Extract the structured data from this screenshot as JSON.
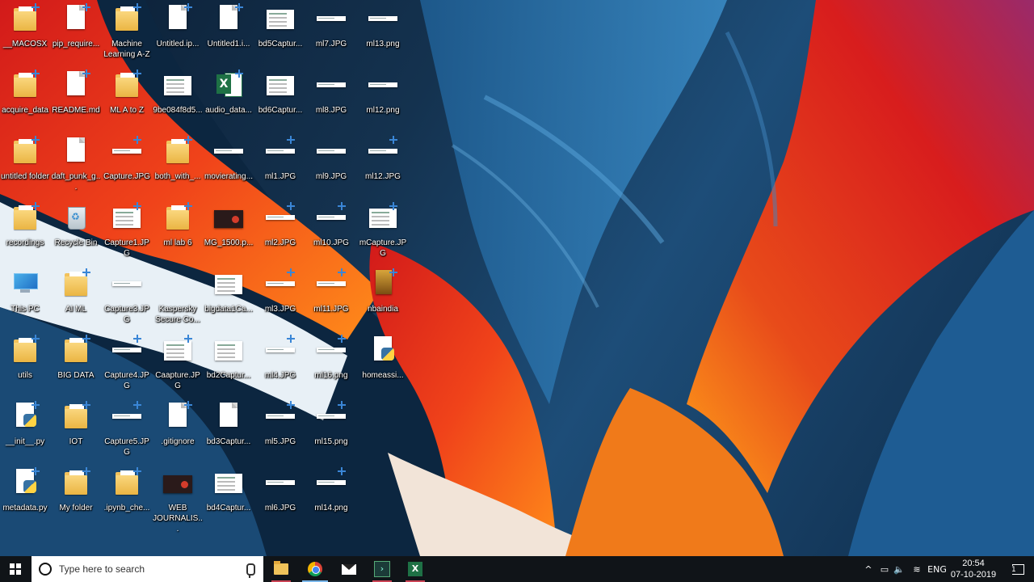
{
  "desktop": {
    "icons": [
      {
        "label": "__MACOSX",
        "kind": "folder",
        "badge": true
      },
      {
        "label": "acquire_data",
        "kind": "folder",
        "badge": true
      },
      {
        "label": "untitled folder",
        "kind": "folder",
        "badge": true
      },
      {
        "label": "recordings",
        "kind": "folder",
        "badge": true
      },
      {
        "label": "This PC",
        "kind": "pc",
        "badge": false
      },
      {
        "label": "utils",
        "kind": "folder",
        "badge": true
      },
      {
        "label": "__init__.py",
        "kind": "python",
        "badge": true
      },
      {
        "label": "metadata.py",
        "kind": "python",
        "badge": true
      },
      {
        "label": "pip_require...",
        "kind": "doc",
        "badge": true
      },
      {
        "label": "README.md",
        "kind": "doc",
        "badge": true
      },
      {
        "label": "daft_punk_g...",
        "kind": "doc",
        "badge": false
      },
      {
        "label": "Recycle Bin",
        "kind": "bin",
        "badge": false
      },
      {
        "label": "AI ML",
        "kind": "folder",
        "badge": true
      },
      {
        "label": "BIG DATA",
        "kind": "folder",
        "badge": true
      },
      {
        "label": "IOT",
        "kind": "folder",
        "badge": true
      },
      {
        "label": "My folder",
        "kind": "folder",
        "badge": true
      },
      {
        "label": "Machine Learning A-Z",
        "kind": "folder",
        "badge": true
      },
      {
        "label": "ML A to Z",
        "kind": "folder",
        "badge": true
      },
      {
        "label": "Capture.JPG",
        "kind": "strip",
        "badge": true
      },
      {
        "label": "Capture1.JPG",
        "kind": "shot",
        "badge": true
      },
      {
        "label": "Capture3.JPG",
        "kind": "strip",
        "badge": false
      },
      {
        "label": "Capture4.JPG",
        "kind": "strip",
        "badge": true
      },
      {
        "label": "Capture5.JPG",
        "kind": "strip",
        "badge": true
      },
      {
        "label": ".ipynb_che...",
        "kind": "folder",
        "badge": true
      },
      {
        "label": "Untitled.ip...",
        "kind": "doc",
        "badge": true
      },
      {
        "label": "9be084f8d5...",
        "kind": "shot",
        "badge": false
      },
      {
        "label": "both_with_...",
        "kind": "folder",
        "badge": true
      },
      {
        "label": "ml lab 6",
        "kind": "folder",
        "badge": true
      },
      {
        "label": "Kaspersky Secure Co...",
        "kind": "kaspersky",
        "badge": false
      },
      {
        "label": "Caapture.JPG",
        "kind": "shot",
        "badge": true
      },
      {
        "label": ".gitignore",
        "kind": "doc",
        "badge": true
      },
      {
        "label": "WEB JOURNALIS...",
        "kind": "dark",
        "badge": false
      },
      {
        "label": "Untitled1.i...",
        "kind": "doc",
        "badge": true
      },
      {
        "label": "audio_data...",
        "kind": "excel",
        "badge": true
      },
      {
        "label": "movierating...",
        "kind": "strip",
        "badge": false
      },
      {
        "label": "MG_1500.p...",
        "kind": "dark",
        "badge": false
      },
      {
        "label": "bigdata1Ca...",
        "kind": "shot",
        "badge": false
      },
      {
        "label": "bd2Captur...",
        "kind": "shot",
        "badge": false
      },
      {
        "label": "bd3Captur...",
        "kind": "doc",
        "badge": false
      },
      {
        "label": "bd4Captur...",
        "kind": "shot",
        "badge": false
      },
      {
        "label": "bd5Captur...",
        "kind": "shot",
        "badge": false
      },
      {
        "label": "bd6Captur...",
        "kind": "shot",
        "badge": false
      },
      {
        "label": "ml1.JPG",
        "kind": "strip",
        "badge": true
      },
      {
        "label": "ml2.JPG",
        "kind": "strip",
        "badge": true
      },
      {
        "label": "ml3.JPG",
        "kind": "strip",
        "badge": true
      },
      {
        "label": "ml4.JPG",
        "kind": "strip",
        "badge": true
      },
      {
        "label": "ml5.JPG",
        "kind": "strip",
        "badge": true
      },
      {
        "label": "ml6.JPG",
        "kind": "strip",
        "badge": false
      },
      {
        "label": "ml7.JPG",
        "kind": "strip",
        "badge": false
      },
      {
        "label": "ml8.JPG",
        "kind": "strip",
        "badge": false
      },
      {
        "label": "ml9.JPG",
        "kind": "strip",
        "badge": false
      },
      {
        "label": "ml10.JPG",
        "kind": "strip",
        "badge": true
      },
      {
        "label": "ml11.JPG",
        "kind": "strip",
        "badge": true
      },
      {
        "label": "ml16.png",
        "kind": "strip",
        "badge": true
      },
      {
        "label": "ml15.png",
        "kind": "strip",
        "badge": true
      },
      {
        "label": "ml14.png",
        "kind": "strip",
        "badge": true
      },
      {
        "label": "ml13.png",
        "kind": "strip",
        "badge": false
      },
      {
        "label": "ml12.png",
        "kind": "strip",
        "badge": false
      },
      {
        "label": "ml12.JPG",
        "kind": "strip",
        "badge": true
      },
      {
        "label": "mCapture.JPG",
        "kind": "shot",
        "badge": true
      },
      {
        "label": "nbaindia",
        "kind": "book",
        "badge": true
      },
      {
        "label": "homeassi...",
        "kind": "python",
        "badge": false
      }
    ]
  },
  "taskbar": {
    "search_placeholder": "Type here to search",
    "language": "ENG",
    "time": "20:54",
    "date": "07-10-2019",
    "notification_count": "1",
    "apps": [
      {
        "name": "file-explorer",
        "state": "running"
      },
      {
        "name": "chrome",
        "state": "active"
      },
      {
        "name": "mail",
        "state": "none"
      },
      {
        "name": "powershell",
        "state": "running"
      },
      {
        "name": "excel",
        "state": "running"
      }
    ]
  },
  "colors": {
    "taskbar_bg": "#101418",
    "folder": "#f2c25c",
    "excel": "#1e7145",
    "accent": "#7ab7ea"
  }
}
